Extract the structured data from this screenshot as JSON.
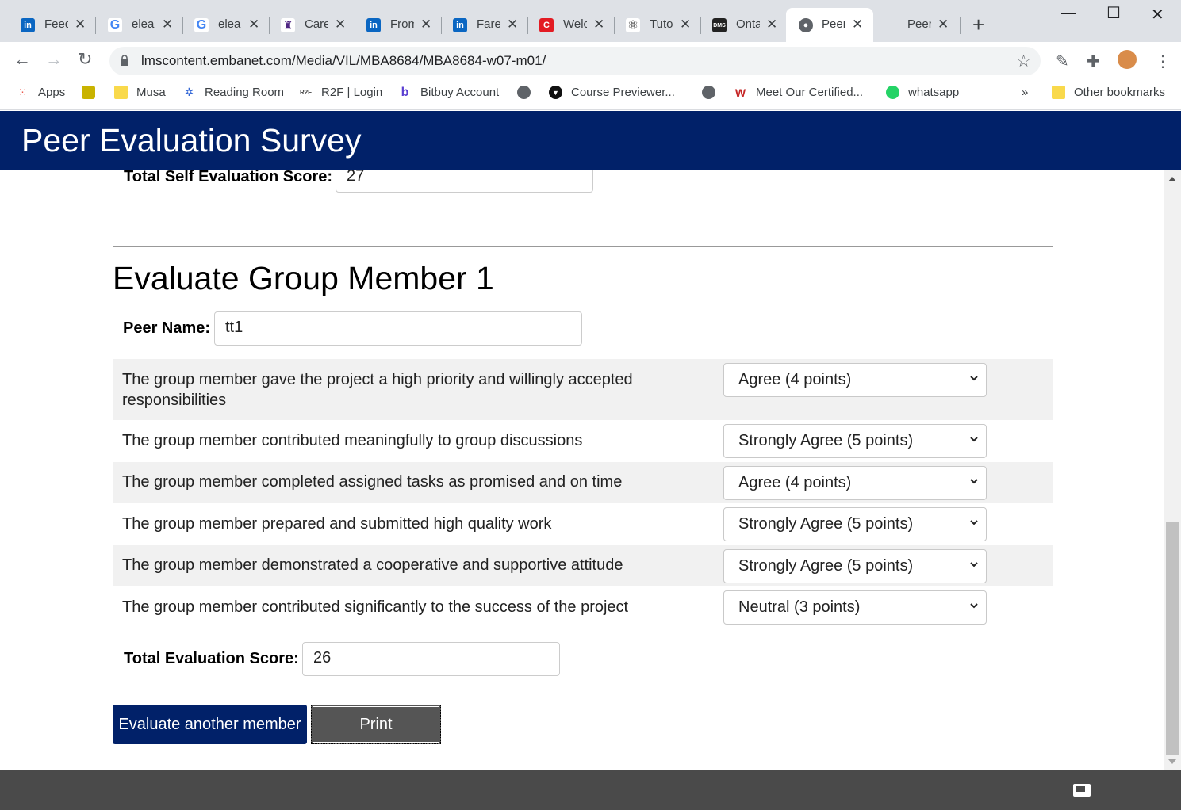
{
  "browser": {
    "tabs": [
      {
        "title": "Feed",
        "favicon": "linkedin-icon",
        "color": "#0a66c2"
      },
      {
        "title": "elea",
        "favicon": "google-icon",
        "color": "#4285f4"
      },
      {
        "title": "elea",
        "favicon": "google-icon",
        "color": "#4285f4"
      },
      {
        "title": "Care",
        "favicon": "western-icon",
        "color": "#4f2683"
      },
      {
        "title": "From",
        "favicon": "linkedin-icon",
        "color": "#0a66c2"
      },
      {
        "title": "Fare",
        "favicon": "linkedin-icon",
        "color": "#0a66c2"
      },
      {
        "title": "Welc",
        "favicon": "c-icon",
        "color": "#e31b23"
      },
      {
        "title": "Tuto",
        "favicon": "react-icon",
        "color": "#222"
      },
      {
        "title": "Onta",
        "favicon": "dms-icon",
        "color": "#222"
      },
      {
        "title": "Peer",
        "favicon": "globe-icon",
        "color": "#5f6368",
        "active": true
      },
      {
        "title": "Peer",
        "favicon": "none",
        "color": "#5f6368"
      }
    ],
    "url": "lmscontent.embanet.com/Media/VIL/MBA8684/MBA8684-w07-m01/",
    "bookmarks": [
      {
        "label": "Apps",
        "icon": "apps-grid-icon"
      },
      {
        "label": "",
        "icon": "turtle-icon"
      },
      {
        "label": "Musa",
        "icon": "folder-icon"
      },
      {
        "label": "Reading Room",
        "icon": "reading-room-icon"
      },
      {
        "label": "R2F | Login",
        "icon": "r2f-icon"
      },
      {
        "label": "Bitbuy Account",
        "icon": "bitbuy-icon"
      },
      {
        "label": "",
        "icon": "globe-icon"
      },
      {
        "label": "Course Previewer...",
        "icon": "course-previewer-icon"
      },
      {
        "label": "",
        "icon": "globe-icon"
      },
      {
        "label": "Meet Our Certified...",
        "icon": "meet-icon"
      },
      {
        "label": "whatsapp",
        "icon": "whatsapp-icon"
      },
      {
        "label": "»",
        "icon": "none"
      },
      {
        "label": "Other bookmarks",
        "icon": "folder-icon"
      }
    ]
  },
  "page": {
    "header_title": "Peer Evaluation Survey",
    "self_eval": {
      "label": "Total Self Evaluation Score:",
      "value": "27"
    },
    "section_heading": "Evaluate Group Member 1",
    "peer_name": {
      "label": "Peer Name:",
      "value": "tt1"
    },
    "questions": [
      {
        "text": "The group member gave the project a high priority and willingly accepted responsibilities",
        "answer": "Agree (4 points)"
      },
      {
        "text": "The group member contributed meaningfully to group discussions",
        "answer": "Strongly Agree (5 points)"
      },
      {
        "text": "The group member completed assigned tasks as promised and on time",
        "answer": "Agree (4 points)"
      },
      {
        "text": "The group member prepared and submitted high quality work",
        "answer": "Strongly Agree (5 points)"
      },
      {
        "text": "The group member demonstrated a cooperative and supportive attitude",
        "answer": "Strongly Agree (5 points)"
      },
      {
        "text": "The group member contributed significantly to the success of the project",
        "answer": "Neutral (3 points)"
      }
    ],
    "total_eval": {
      "label": "Total Evaluation Score:",
      "value": "26"
    },
    "buttons": {
      "evaluate_another": "Evaluate another member",
      "print": "Print"
    }
  },
  "colors": {
    "header_bg": "#012169",
    "footer_bg": "#4a4a4a",
    "row_shade": "#f1f1f1"
  }
}
